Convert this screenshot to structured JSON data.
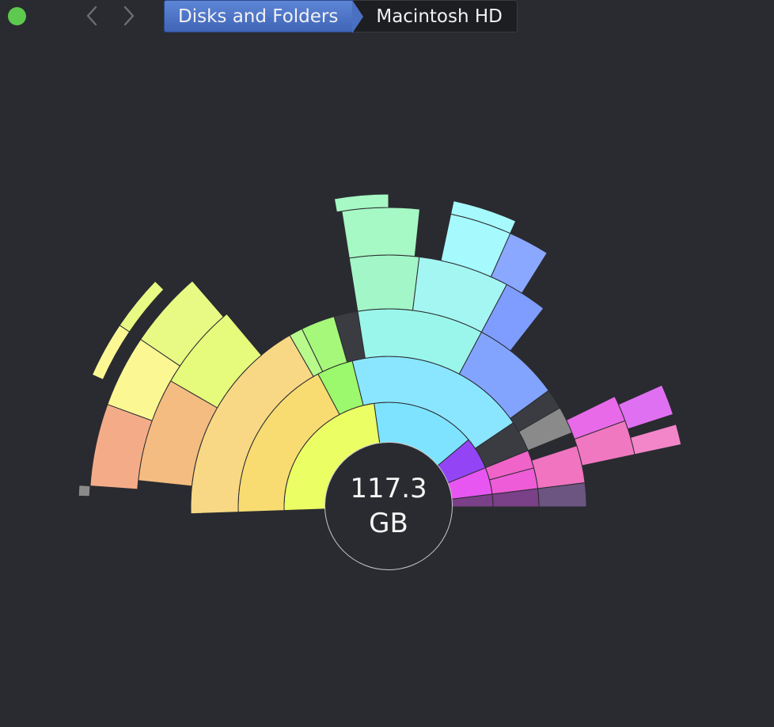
{
  "toolbar": {
    "back_icon": "chevron-left-icon",
    "forward_icon": "chevron-right-icon",
    "breadcrumb": [
      "Disks and Folders",
      "Macintosh HD"
    ]
  },
  "center": {
    "size_value": "117.3",
    "size_unit": "GB"
  },
  "colors": {
    "background": "#2a2b30",
    "breadcrumb_active": "#4a70c2",
    "window_close_dot": "#5ec94f"
  }
}
